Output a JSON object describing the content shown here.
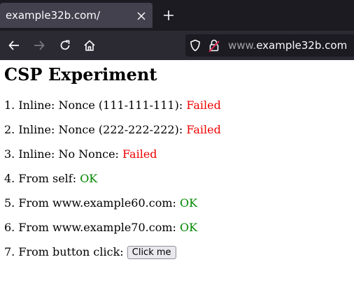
{
  "browser": {
    "tab_title": "example32b.com/",
    "url_prefix": "www.",
    "url_host": "example32b.com",
    "icons": [
      "close-icon",
      "plus-icon",
      "back-icon",
      "forward-icon",
      "reload-icon",
      "home-icon",
      "shield-icon",
      "lock-icon"
    ]
  },
  "page": {
    "heading": "CSP Experiment",
    "items": [
      {
        "label": "1. Inline: Nonce (111-111-111): ",
        "status": "Failed"
      },
      {
        "label": "2. Inline: Nonce (222-222-222): ",
        "status": "Failed"
      },
      {
        "label": "3. Inline: No Nonce: ",
        "status": "Failed"
      },
      {
        "label": "4. From self: ",
        "status": "OK"
      },
      {
        "label": "5. From www.example60.com: ",
        "status": "OK"
      },
      {
        "label": "6. From www.example70.com: ",
        "status": "OK"
      },
      {
        "label": "7. From button click: ",
        "button": "Click me"
      }
    ]
  },
  "colors": {
    "failed": "#ee0000",
    "ok": "#008800"
  }
}
